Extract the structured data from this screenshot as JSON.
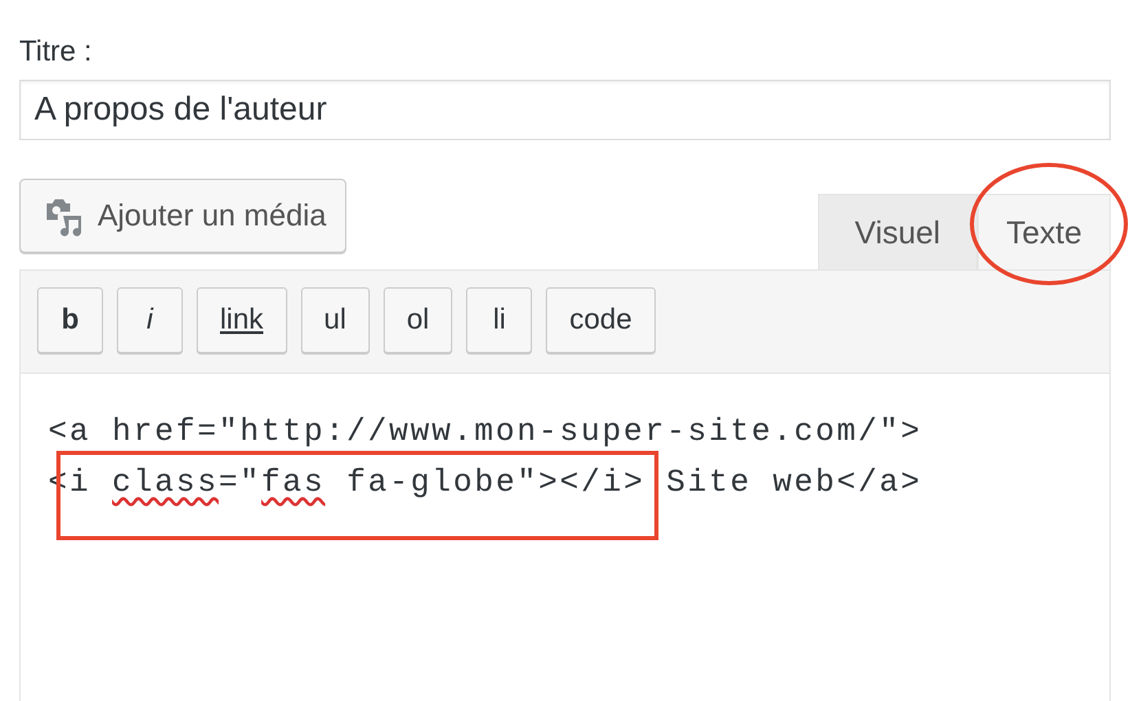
{
  "title_field": {
    "label": "Titre :",
    "value": "A propos de l'auteur"
  },
  "media_button": {
    "label": "Ajouter un média"
  },
  "tabs": [
    {
      "label": "Visuel",
      "selected": false,
      "circled": false
    },
    {
      "label": "Texte",
      "selected": true,
      "circled": true
    }
  ],
  "toolbar": [
    {
      "label": "b",
      "kind": "bold"
    },
    {
      "label": "i",
      "kind": "italic"
    },
    {
      "label": "link",
      "kind": "underline"
    },
    {
      "label": "ul",
      "kind": "plain"
    },
    {
      "label": "ol",
      "kind": "plain"
    },
    {
      "label": "li",
      "kind": "plain"
    },
    {
      "label": "code",
      "kind": "plain"
    }
  ],
  "code_lines": [
    {
      "boxed": false,
      "segments": [
        {
          "text": "<a href=\"http://www.mon-super-site.com/\">",
          "misspelled": false
        }
      ]
    },
    {
      "boxed": true,
      "segments": [
        {
          "text": "<i ",
          "misspelled": false
        },
        {
          "text": "class",
          "misspelled": true
        },
        {
          "text": "=\"",
          "misspelled": false
        },
        {
          "text": "fas",
          "misspelled": true
        },
        {
          "text": " fa-globe\"></i> Site web</a>",
          "misspelled": false
        }
      ]
    }
  ]
}
